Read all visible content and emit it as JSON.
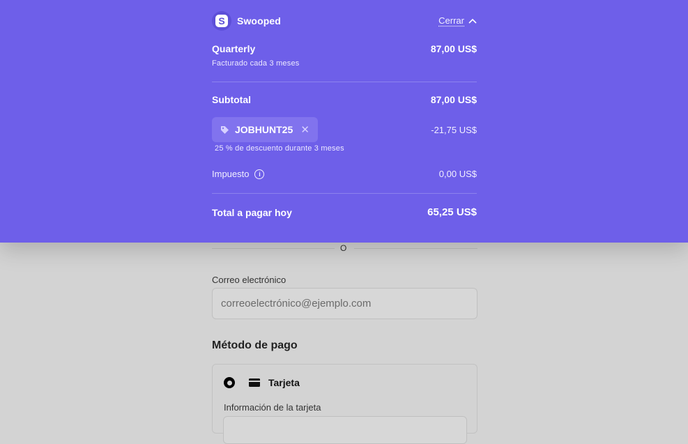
{
  "summary": {
    "brand_name": "Swooped",
    "close_label": "Cerrar",
    "plan": {
      "name": "Quarterly",
      "billing": "Facturado cada 3 meses",
      "price": "87,00 US$"
    },
    "subtotal": {
      "label": "Subtotal",
      "value": "87,00 US$"
    },
    "coupon": {
      "code": "JOBHUNT25",
      "discount": "-21,75 US$",
      "note": "25 % de descuento durante 3 meses"
    },
    "tax": {
      "label": "Impuesto",
      "value": "0,00 US$"
    },
    "total": {
      "label": "Total a pagar hoy",
      "value": "65,25 US$"
    },
    "accent_color": "#6e5fe9"
  },
  "form": {
    "divider_text": "O",
    "email": {
      "label": "Correo electrónico",
      "placeholder": "correoelectrónico@ejemplo.com"
    },
    "payment": {
      "title": "Método de pago",
      "option_label": "Tarjeta",
      "card_info_label": "Información de la tarjeta"
    }
  }
}
